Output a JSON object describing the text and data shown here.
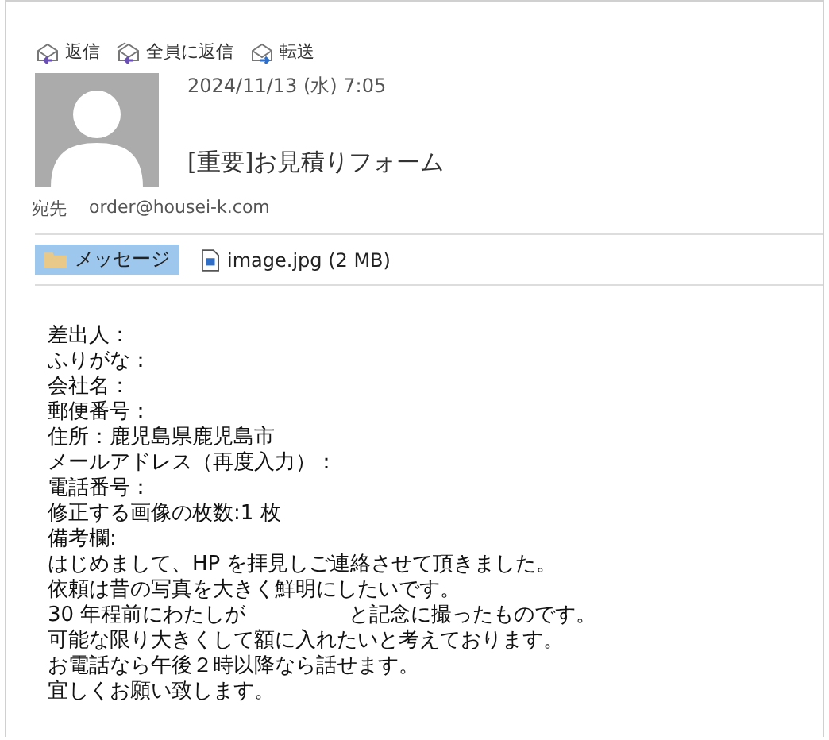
{
  "actions": [
    {
      "label": "返信",
      "kind": "reply"
    },
    {
      "label": "全員に返信",
      "kind": "reply_all"
    },
    {
      "label": "転送",
      "kind": "forward"
    }
  ],
  "message": {
    "date": "2024/11/13 (水) 7:05",
    "subject": "[重要]お見積りフォーム",
    "to_label": "宛先",
    "to": "order@housei-k.com"
  },
  "tabs": [
    {
      "label": "メッセージ",
      "kind": "message",
      "selected": true
    },
    {
      "label": "image.jpg (2 MB)",
      "kind": "attachment",
      "selected": false
    }
  ],
  "body": [
    "差出人：",
    "ふりがな：",
    "会社名：",
    "郵便番号：",
    "住所：鹿児島県鹿児島市",
    "メールアドレス（再度入力）：",
    "電話番号：",
    "修正する画像の枚数:1 枚",
    "備考欄:",
    "はじめまして、HP を拝見しご連絡させて頂きました。",
    "依頼は昔の写真を大きく鮮明にしたいです。",
    "30 年程前にわたしが　　　　　と記念に撮ったものです。",
    "可能な限り大きくして額に入れたいと考えております。",
    "お電話なら午後２時以降なら話せます。",
    "宜しくお願い致します。"
  ]
}
